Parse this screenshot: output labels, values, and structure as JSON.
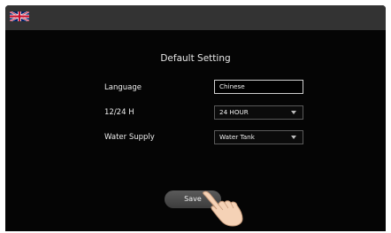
{
  "header": {
    "flag_icon": "uk-flag-icon"
  },
  "title": "Default Setting",
  "settings": [
    {
      "label": "Language",
      "value": "Chinese",
      "control": "input"
    },
    {
      "label": "12/24 H",
      "value": "24 HOUR",
      "control": "select"
    },
    {
      "label": "Water Supply",
      "value": "Water Tank",
      "control": "select"
    }
  ],
  "save_label": "Save",
  "colors": {
    "background": "#050505",
    "topbar": "#333333",
    "button": "#4a4a4a"
  }
}
